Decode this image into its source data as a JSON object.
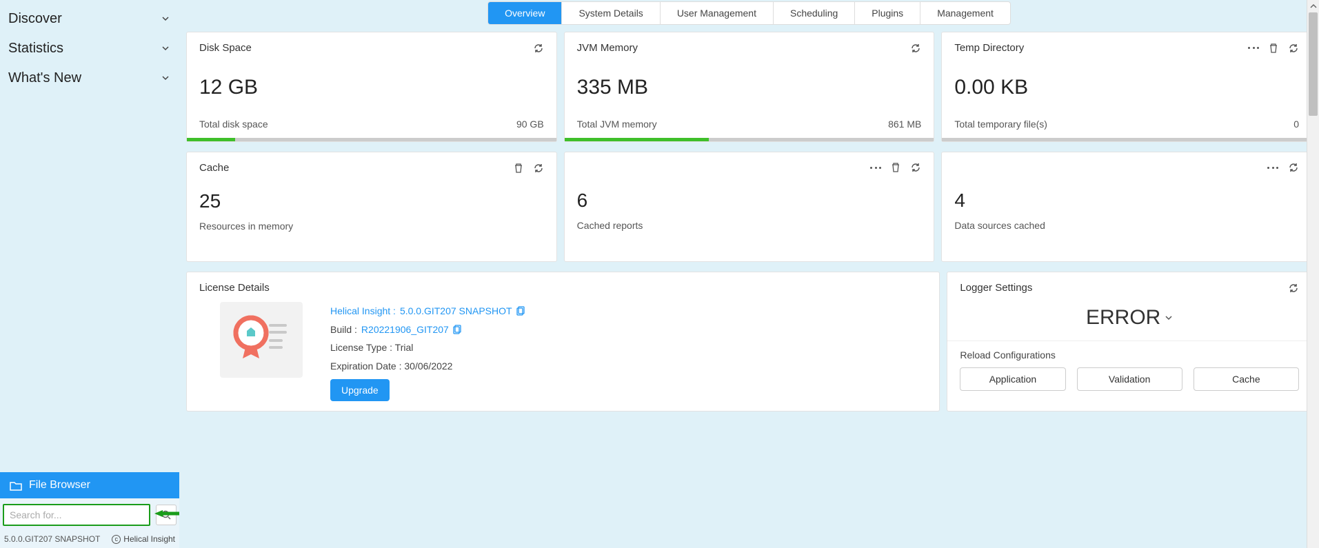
{
  "sidebar": {
    "items": [
      {
        "label": "Discover"
      },
      {
        "label": "Statistics"
      },
      {
        "label": "What's New"
      }
    ],
    "file_browser_label": "File Browser",
    "search_placeholder": "Search for...",
    "version": "5.0.0.GIT207 SNAPSHOT",
    "brand": "Helical Insight"
  },
  "tabs": [
    {
      "label": "Overview",
      "active": true
    },
    {
      "label": "System Details"
    },
    {
      "label": "User Management"
    },
    {
      "label": "Scheduling"
    },
    {
      "label": "Plugins"
    },
    {
      "label": "Management"
    }
  ],
  "cards_row1": {
    "disk": {
      "title": "Disk Space",
      "value": "12 GB",
      "sub_label": "Total disk space",
      "sub_value": "90 GB",
      "fill_pct": 13
    },
    "jvm": {
      "title": "JVM Memory",
      "value": "335 MB",
      "sub_label": "Total JVM memory",
      "sub_value": "861 MB",
      "fill_pct": 39
    },
    "temp": {
      "title": "Temp Directory",
      "value": "0.00 KB",
      "sub_label": "Total temporary file(s)",
      "sub_value": "0",
      "fill_pct": 0
    }
  },
  "cards_row2": {
    "cache": {
      "title": "Cache",
      "value": "25",
      "sub_label": "Resources in memory"
    },
    "reports": {
      "value": "6",
      "sub_label": "Cached reports"
    },
    "datasources": {
      "value": "4",
      "sub_label": "Data sources cached"
    }
  },
  "license": {
    "title": "License Details",
    "product_label": "Helical Insight :",
    "product_value": "5.0.0.GIT207 SNAPSHOT",
    "build_label": "Build :",
    "build_value": "R20221906_GIT207",
    "type_label": "License Type :",
    "type_value": "Trial",
    "exp_label": "Expiration Date :",
    "exp_value": "30/06/2022",
    "upgrade_label": "Upgrade"
  },
  "logger": {
    "title": "Logger Settings",
    "level": "ERROR",
    "reload_title": "Reload Configurations",
    "buttons": [
      "Application",
      "Validation",
      "Cache"
    ]
  }
}
